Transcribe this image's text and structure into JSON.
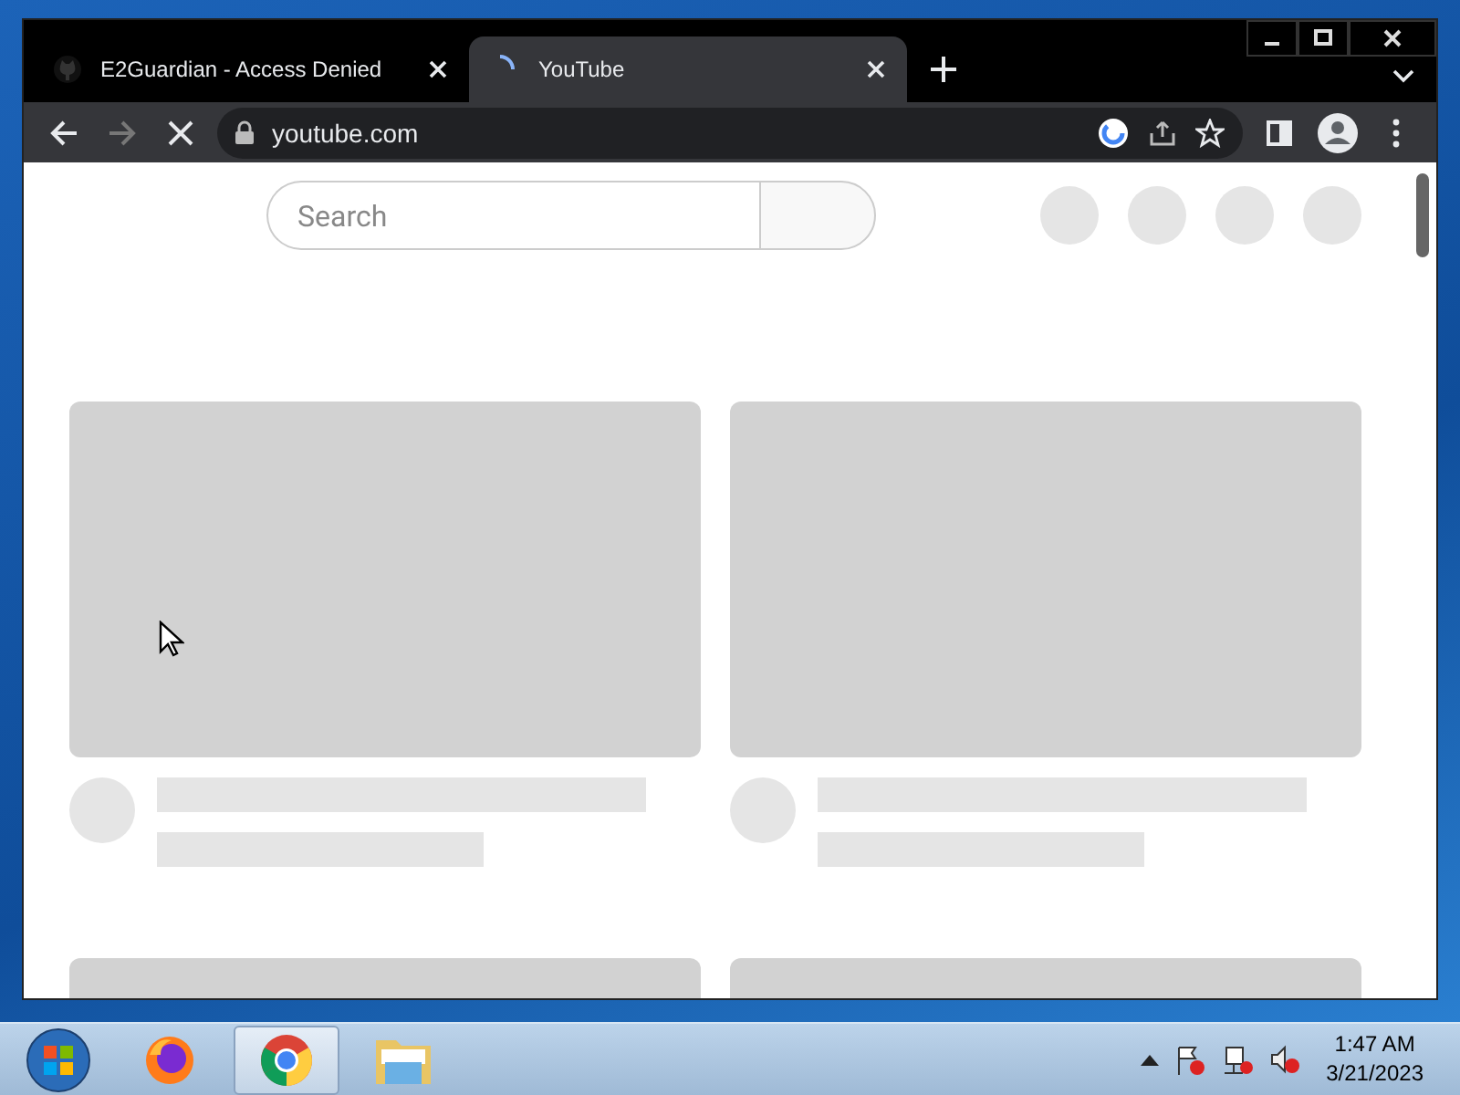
{
  "browser": {
    "tabs": [
      {
        "title": "E2Guardian - Access Denied",
        "selected": false,
        "loading": false
      },
      {
        "title": "YouTube",
        "selected": true,
        "loading": true
      }
    ],
    "address": "youtube.com",
    "loading": true
  },
  "page": {
    "search": {
      "placeholder": "Search"
    }
  },
  "taskbar": {
    "apps": [
      {
        "kind": "firefox",
        "selected": false
      },
      {
        "kind": "chrome",
        "selected": true
      },
      {
        "kind": "folder",
        "selected": false
      }
    ],
    "clock": {
      "time": "1:47 AM",
      "date": "3/21/2023"
    }
  }
}
